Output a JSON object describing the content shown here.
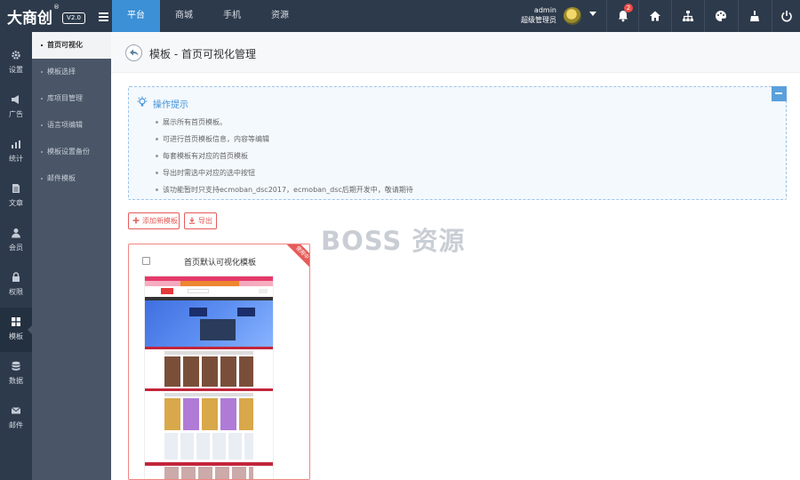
{
  "brand": {
    "logo": "大商创",
    "reg": "®",
    "version": "V2.0"
  },
  "nav": {
    "tabs": [
      {
        "label": "平台",
        "active": true
      },
      {
        "label": "商城",
        "active": false
      },
      {
        "label": "手机",
        "active": false
      },
      {
        "label": "资源",
        "active": false
      }
    ]
  },
  "user": {
    "name": "admin",
    "role": "超级管理员"
  },
  "notifications": {
    "count": "2"
  },
  "icons": {
    "menu": "menu-toggle-icon",
    "bell": "bell-icon",
    "home": "home-icon",
    "sitemap": "sitemap-icon",
    "palette": "palette-icon",
    "broom": "broom-icon",
    "power": "power-icon"
  },
  "sidebar": {
    "items": [
      {
        "label": "设置",
        "icon": "gear-icon"
      },
      {
        "label": "广告",
        "icon": "megaphone-icon"
      },
      {
        "label": "统计",
        "icon": "chart-icon"
      },
      {
        "label": "文章",
        "icon": "document-icon"
      },
      {
        "label": "会员",
        "icon": "user-icon"
      },
      {
        "label": "权限",
        "icon": "lock-icon"
      },
      {
        "label": "模板",
        "icon": "grid-icon",
        "active": true
      },
      {
        "label": "数据",
        "icon": "database-icon"
      },
      {
        "label": "邮件",
        "icon": "mail-icon"
      }
    ]
  },
  "submenu": {
    "items": [
      {
        "label": "首页可视化",
        "active": true
      },
      {
        "label": "模板选择"
      },
      {
        "label": "库项目管理"
      },
      {
        "label": "语言项编辑"
      },
      {
        "label": "模板设置备份"
      },
      {
        "label": "邮件模板"
      }
    ]
  },
  "page": {
    "title": "模板 - 首页可视化管理"
  },
  "tips": {
    "title": "操作提示",
    "items": [
      "展示所有首页模板。",
      "可进行首页模板信息，内容等编辑",
      "每套模板有对应的首页模板",
      "导出时需选中对应的选中按钮",
      "该功能暂时只支持ecmoban_dsc2017，ecmoban_dsc后期开发中，敬请期待"
    ]
  },
  "actions": {
    "add": "添加新模板",
    "export": "导出"
  },
  "watermark": "BOSS 资源",
  "template_card": {
    "name": "首页默认可视化模板",
    "ribbon": "使用中"
  },
  "colors": {
    "topbar": "#2d3a4b",
    "accent": "#3c90d6",
    "danger": "#e65b58",
    "submenu": "#4a5667"
  }
}
